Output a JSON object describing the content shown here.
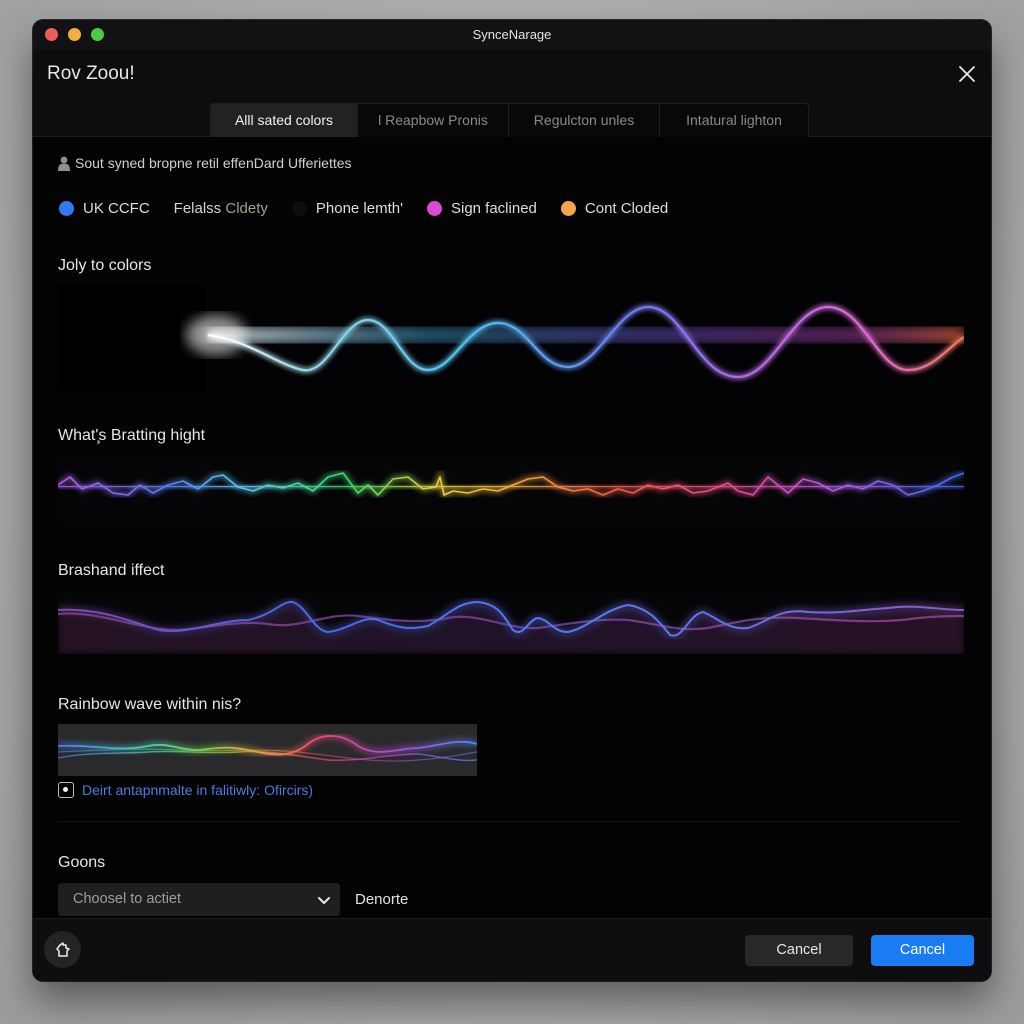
{
  "window": {
    "title": "SynceNarage",
    "traffic_lights": [
      "close",
      "minimize",
      "maximize"
    ]
  },
  "dialog": {
    "title": "Rov Zoou!",
    "close_icon": "close-icon"
  },
  "tabs": [
    {
      "label": "Alll sated colors",
      "active": true
    },
    {
      "label": "l Reapbow Pronis",
      "active": false
    },
    {
      "label": "Regulcton unles",
      "active": false
    },
    {
      "label": "Intatural lighton",
      "active": false
    }
  ],
  "info": {
    "icon": "person-icon",
    "text": "Sout syned bropne retil effenDard Ufferiettes"
  },
  "legend": [
    {
      "label": "UK CCFC",
      "color": "#2f7cf0",
      "has_dot": true
    },
    {
      "label_a": "Felalss ",
      "label_b": "Cldety",
      "color": null,
      "has_dot": false
    },
    {
      "label": "Phone lemth'",
      "color": "#0c0d12",
      "has_dot": true
    },
    {
      "label": "Sign faclined",
      "color": "#d94bd0",
      "has_dot": true
    },
    {
      "label": "Cont Cloded",
      "color": "#f4a54a",
      "has_dot": true
    }
  ],
  "sections": [
    {
      "label": "Joly to colors",
      "wave": "smooth-spectrum"
    },
    {
      "label": "What'̧s Bratting hight",
      "wave": "rainbow-jitter"
    },
    {
      "label": "Brashand iffect",
      "wave": "blue-violet-ribbon"
    },
    {
      "label": "Rainbow wave within nis?",
      "wave": "rainbow-ribbon-small"
    }
  ],
  "hint": {
    "icon": "info-icon",
    "text": "Deirt antapnmalte in falitiwly: Ofircirs)"
  },
  "goons": {
    "label": "Goons",
    "select_value": "Choosel to actiet",
    "aside_label": "Denorte"
  },
  "footer": {
    "reset_icon": "reset-icon",
    "secondary_button": "Cancel",
    "primary_button": "Cancel"
  },
  "colors": {
    "accent": "#1a7cf2",
    "hint_link": "#4f7ae0",
    "window_bg": "#030304"
  }
}
